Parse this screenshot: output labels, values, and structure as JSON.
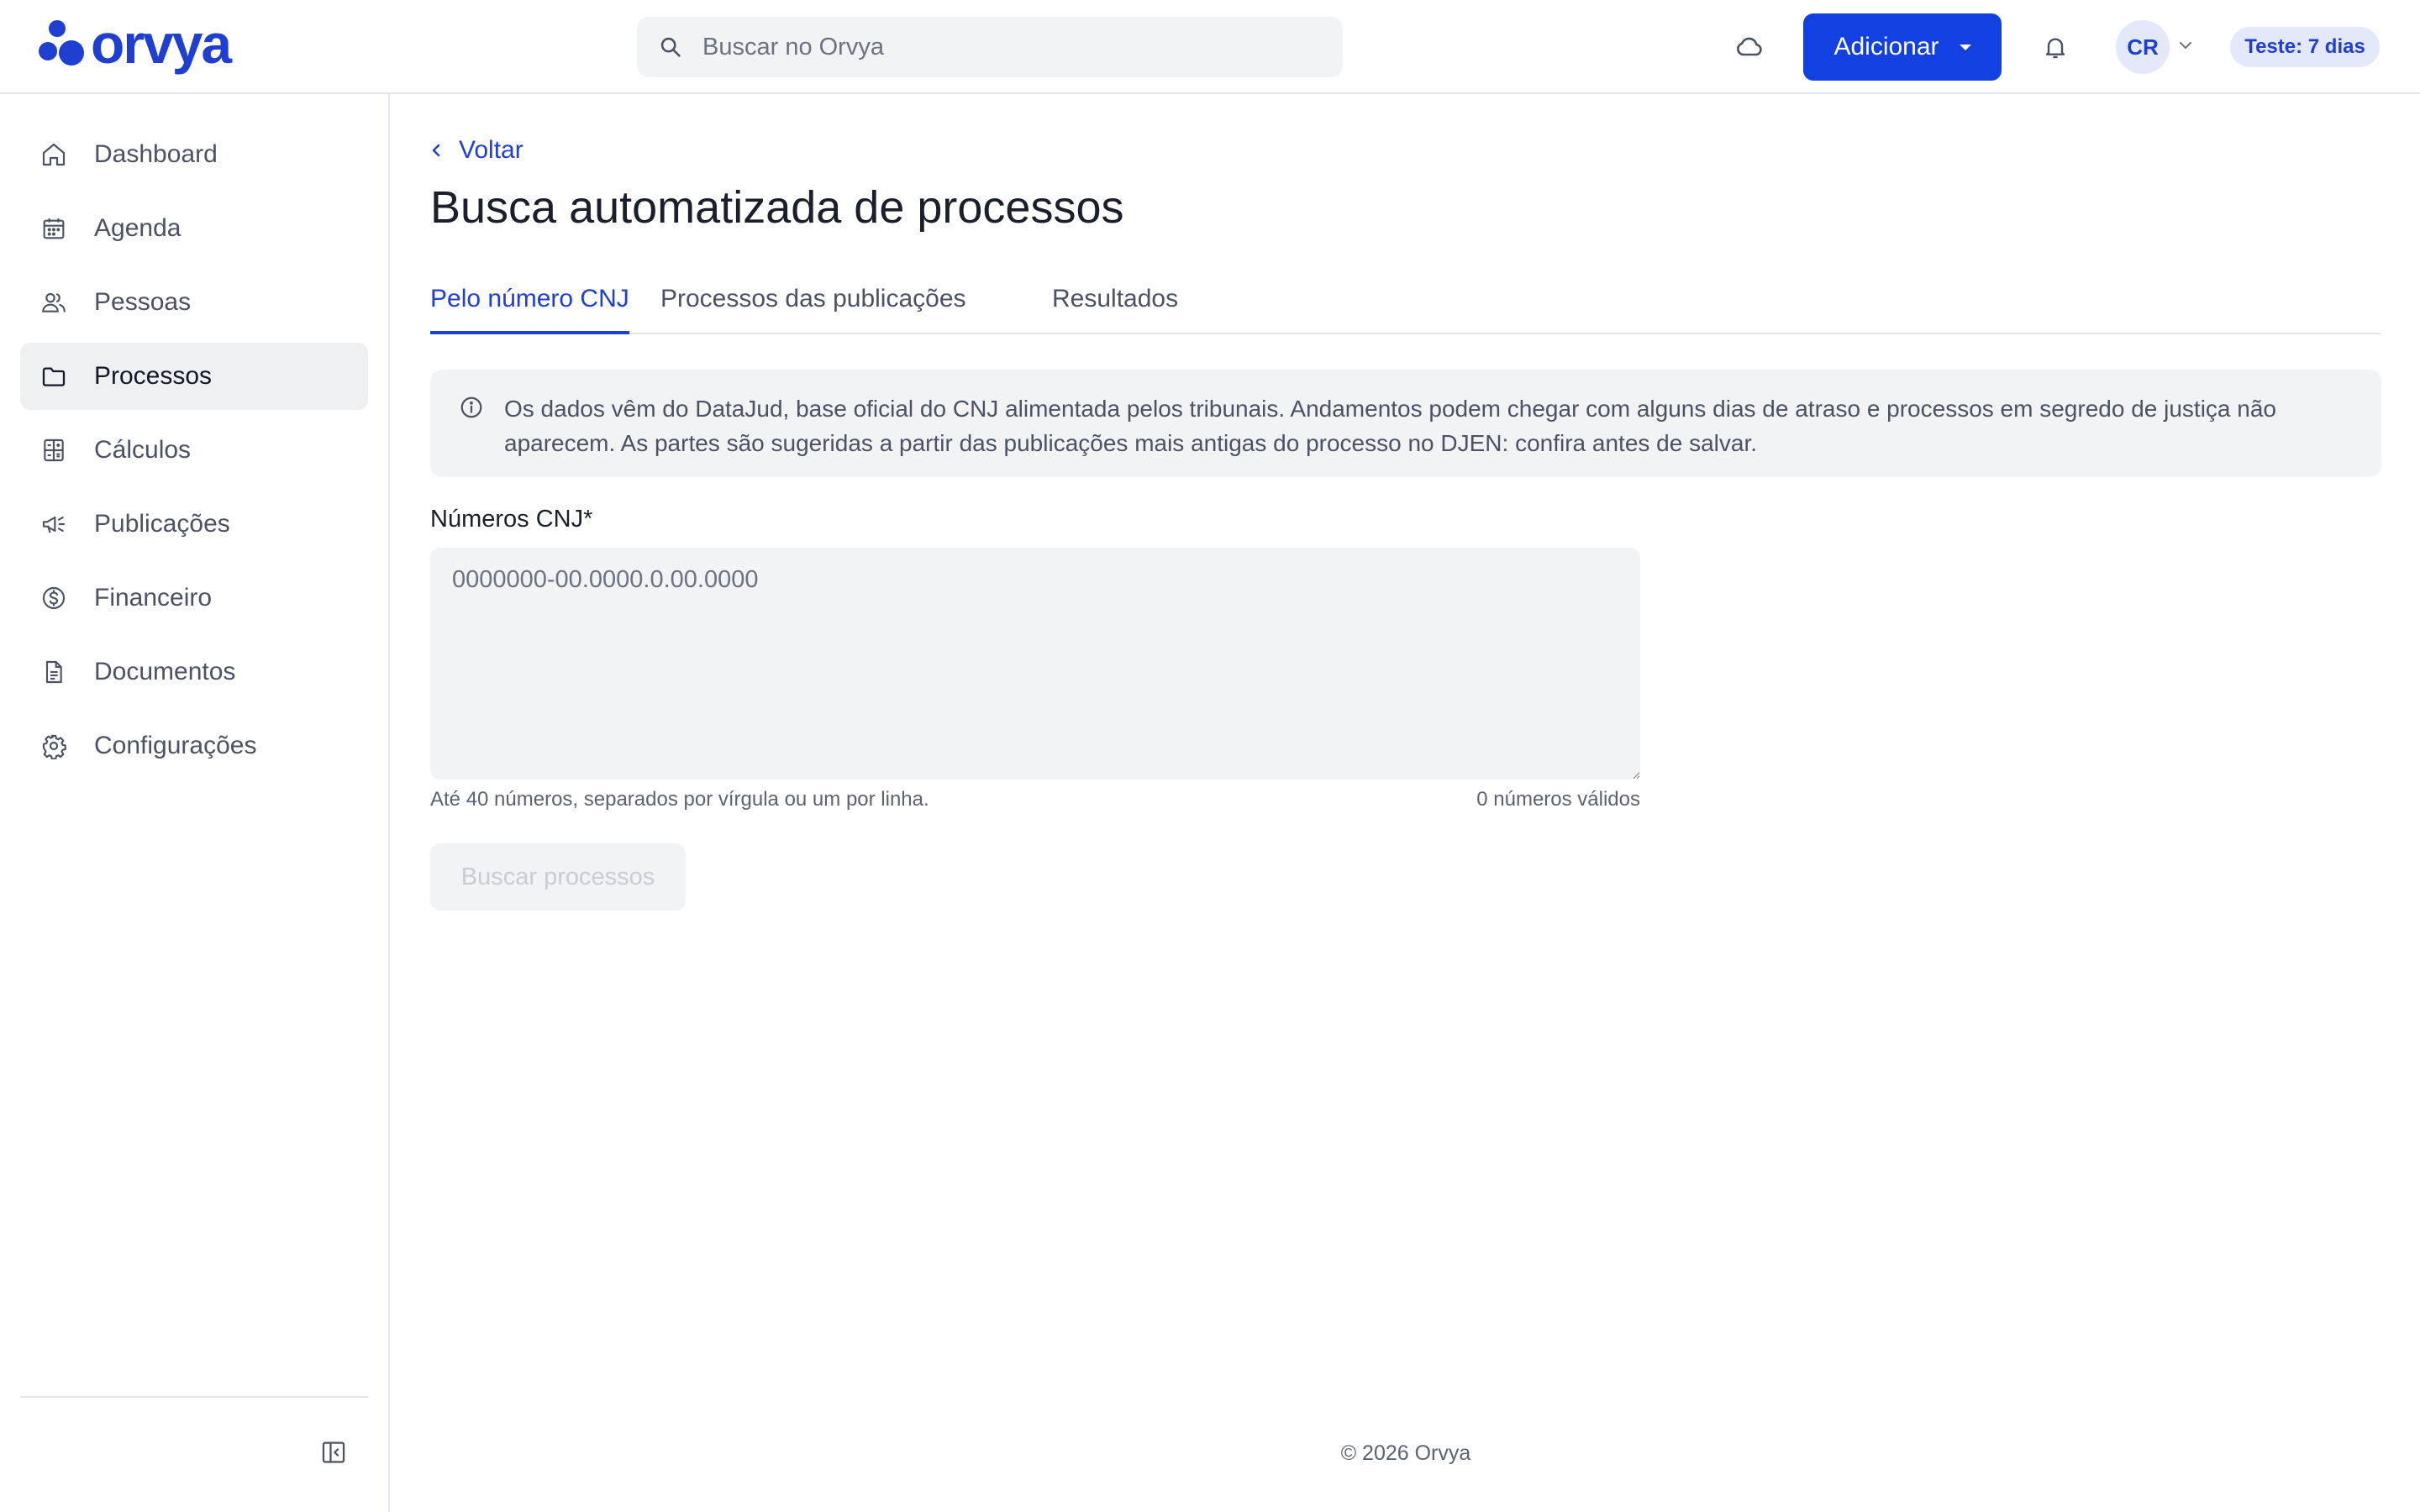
{
  "app": {
    "name": "orvya"
  },
  "header": {
    "search_placeholder": "Buscar no Orvya",
    "add_button": "Adicionar",
    "avatar_initials": "CR",
    "trial_badge": "Teste: 7 dias",
    "icons": [
      "search-icon",
      "cloud-icon",
      "bell-icon",
      "chevron-down-icon"
    ]
  },
  "sidebar": {
    "items": [
      {
        "label": "Dashboard",
        "icon": "home-icon",
        "active": false
      },
      {
        "label": "Agenda",
        "icon": "calendar-icon",
        "active": false
      },
      {
        "label": "Pessoas",
        "icon": "people-icon",
        "active": false
      },
      {
        "label": "Processos",
        "icon": "folder-icon",
        "active": true
      },
      {
        "label": "Cálculos",
        "icon": "calculator-icon",
        "active": false
      },
      {
        "label": "Publicações",
        "icon": "megaphone-icon",
        "active": false
      },
      {
        "label": "Financeiro",
        "icon": "dollar-icon",
        "active": false
      },
      {
        "label": "Documentos",
        "icon": "document-icon",
        "active": false
      },
      {
        "label": "Configurações",
        "icon": "gear-icon",
        "active": false
      }
    ],
    "collapse_icon": "sidebar-collapse-icon"
  },
  "main": {
    "back_label": "Voltar",
    "title": "Busca automatizada de processos",
    "tabs": [
      {
        "label": "Pelo número CNJ",
        "active": true
      },
      {
        "label": "Processos das publicações",
        "active": false
      },
      {
        "label": "Resultados",
        "active": false
      }
    ],
    "info_text": "Os dados vêm do DataJud, base oficial do CNJ alimentada pelos tribunais. Andamentos podem chegar com alguns dias de atraso e processos em segredo de justiça não aparecem. As partes são sugeridas a partir das publicações mais antigas do processo no DJEN: confira antes de salvar.",
    "field_label": "Números CNJ*",
    "field_value": "",
    "field_placeholder": "0000000-00.0000.0.00.0000",
    "hint": "Até 40 números, separados por vírgula ou um por linha.",
    "valid_count": "0 números válidos",
    "submit_label": "Buscar processos",
    "submit_disabled": true
  },
  "footer": {
    "text": "© 2026 Orvya"
  },
  "colors": {
    "accent": "#1340e0",
    "brand": "#1f3fd1",
    "surface": "#f2f3f5",
    "active_nav": "#eff0f2"
  }
}
